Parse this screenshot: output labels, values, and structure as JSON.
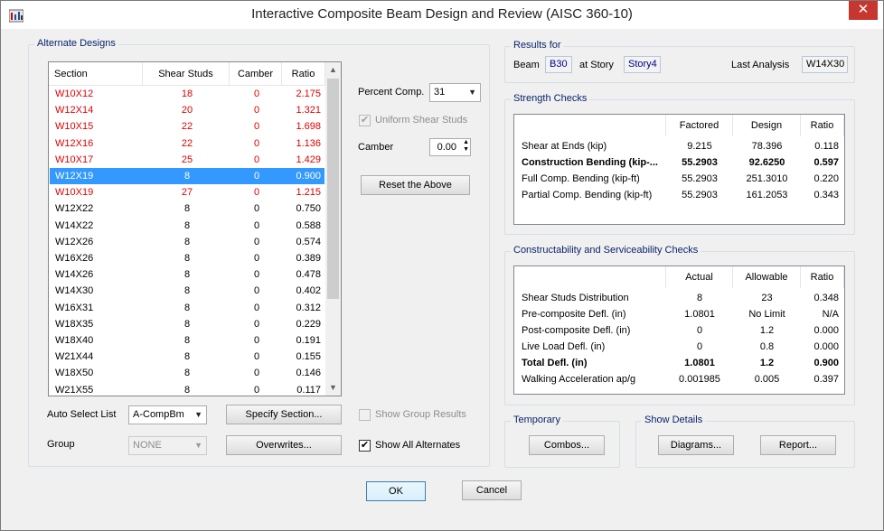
{
  "window": {
    "title": "Interactive Composite Beam Design and Review (AISC 360-10)",
    "close": "✕"
  },
  "alt": {
    "label": "Alternate Designs",
    "columns": [
      "Section",
      "Shear Studs",
      "Camber",
      "Ratio"
    ],
    "rows": [
      {
        "s": "W10X12",
        "st": "18",
        "c": "0",
        "r": "2.175",
        "red": true
      },
      {
        "s": "W12X14",
        "st": "20",
        "c": "0",
        "r": "1.321",
        "red": true
      },
      {
        "s": "W10X15",
        "st": "22",
        "c": "0",
        "r": "1.698",
        "red": true
      },
      {
        "s": "W12X16",
        "st": "22",
        "c": "0",
        "r": "1.136",
        "red": true
      },
      {
        "s": "W10X17",
        "st": "25",
        "c": "0",
        "r": "1.429",
        "red": true
      },
      {
        "s": "W12X19",
        "st": "8",
        "c": "0",
        "r": "0.900",
        "sel": true
      },
      {
        "s": "W10X19",
        "st": "27",
        "c": "0",
        "r": "1.215",
        "red": true
      },
      {
        "s": "W12X22",
        "st": "8",
        "c": "0",
        "r": "0.750"
      },
      {
        "s": "W14X22",
        "st": "8",
        "c": "0",
        "r": "0.588"
      },
      {
        "s": "W12X26",
        "st": "8",
        "c": "0",
        "r": "0.574"
      },
      {
        "s": "W16X26",
        "st": "8",
        "c": "0",
        "r": "0.389"
      },
      {
        "s": "W14X26",
        "st": "8",
        "c": "0",
        "r": "0.478"
      },
      {
        "s": "W14X30",
        "st": "8",
        "c": "0",
        "r": "0.402"
      },
      {
        "s": "W16X31",
        "st": "8",
        "c": "0",
        "r": "0.312"
      },
      {
        "s": "W18X35",
        "st": "8",
        "c": "0",
        "r": "0.229"
      },
      {
        "s": "W18X40",
        "st": "8",
        "c": "0",
        "r": "0.191"
      },
      {
        "s": "W21X44",
        "st": "8",
        "c": "0",
        "r": "0.155"
      },
      {
        "s": "W18X50",
        "st": "8",
        "c": "0",
        "r": "0.146"
      },
      {
        "s": "W21X55",
        "st": "8",
        "c": "0",
        "r": "0.117"
      }
    ],
    "auto_select_label": "Auto Select List",
    "auto_select_value": "A-CompBm",
    "group_label": "Group",
    "group_value": "NONE",
    "specify_btn": "Specify Section...",
    "overwrites_btn": "Overwrites...",
    "percent_comp_label": "Percent Comp.",
    "percent_comp_value": "31",
    "uniform_studs_label": "Uniform Shear Studs",
    "camber_label": "Camber",
    "camber_value": "0.00",
    "reset_btn": "Reset the Above",
    "show_group_label": "Show Group Results",
    "show_all_label": "Show All Alternates"
  },
  "results": {
    "label": "Results for",
    "beam_label": "Beam",
    "beam": "B30",
    "story_label": "at Story",
    "story": "Story4",
    "last_label": "Last Analysis",
    "last": "W14X30"
  },
  "strength": {
    "label": "Strength Checks",
    "cols": [
      "Factored",
      "Design",
      "Ratio"
    ],
    "rows": [
      {
        "n": "Shear at Ends (kip)",
        "a": "9.215",
        "b": "78.396",
        "r": "0.118"
      },
      {
        "n": "Construction Bending (kip-...",
        "a": "55.2903",
        "b": "92.6250",
        "r": "0.597",
        "bold": true
      },
      {
        "n": "Full Comp. Bending (kip-ft)",
        "a": "55.2903",
        "b": "251.3010",
        "r": "0.220"
      },
      {
        "n": "Partial Comp. Bending (kip-ft)",
        "a": "55.2903",
        "b": "161.2053",
        "r": "0.343"
      }
    ]
  },
  "service": {
    "label": "Constructability and Serviceability Checks",
    "cols": [
      "Actual",
      "Allowable",
      "Ratio"
    ],
    "rows": [
      {
        "n": "Shear Studs Distribution",
        "a": "8",
        "b": "23",
        "r": "0.348"
      },
      {
        "n": "Pre-composite Defl. (in)",
        "a": "1.0801",
        "b": "No Limit",
        "r": "N/A"
      },
      {
        "n": "Post-composite Defl. (in)",
        "a": "0",
        "b": "1.2",
        "r": "0.000"
      },
      {
        "n": "Live Load Defl. (in)",
        "a": "0",
        "b": "0.8",
        "r": "0.000"
      },
      {
        "n": "Total Defl. (in)",
        "a": "1.0801",
        "b": "1.2",
        "r": "0.900",
        "bold": true
      },
      {
        "n": "Walking Acceleration ap/g",
        "a": "0.001985",
        "b": "0.005",
        "r": "0.397"
      }
    ]
  },
  "temporary": {
    "label": "Temporary",
    "combos_btn": "Combos..."
  },
  "details": {
    "label": "Show Details",
    "diagrams_btn": "Diagrams...",
    "report_btn": "Report..."
  },
  "footer": {
    "ok": "OK",
    "cancel": "Cancel"
  },
  "colors": {
    "selection": "#3399ff",
    "fail_red": "#e00000",
    "group_label": "#0a246a"
  }
}
